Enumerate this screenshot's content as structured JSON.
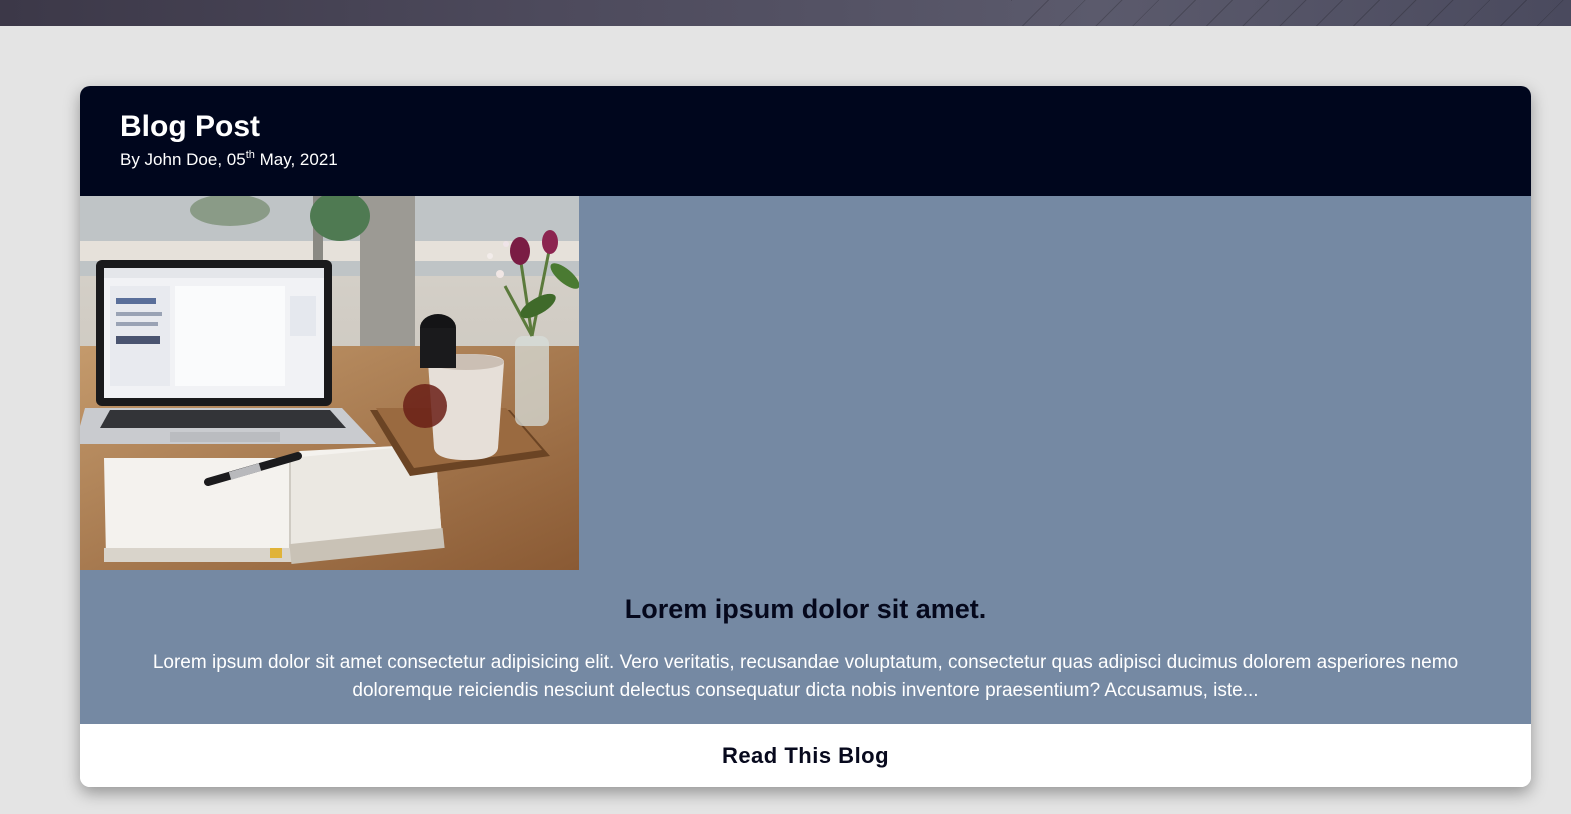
{
  "post": {
    "title": "Blog Post",
    "byline_prefix": "By John Doe, 05",
    "byline_suffix": "th",
    "byline_date": " May, 2021",
    "image_alt": "laptop-desk-photo",
    "heading": "Lorem ipsum dolor sit amet.",
    "excerpt": "Lorem ipsum dolor sit amet consectetur adipisicing elit. Vero veritatis, recusandae voluptatum, consectetur quas adipisci ducimus dolorem asperiores nemo doloremque reiciendis nesciunt delectus consequatur dicta nobis inventore praesentium? Accusamus, iste...",
    "read_button_label": "Read This Blog"
  },
  "colors": {
    "page_background": "#e4e4e4",
    "header_background": "#00061d",
    "body_background": "#7589a3",
    "footer_background": "#ffffff"
  }
}
